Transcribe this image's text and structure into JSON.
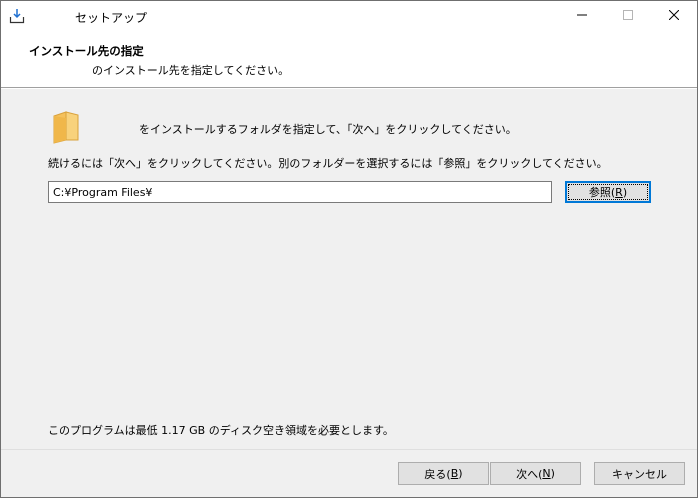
{
  "window": {
    "title": "セットアップ",
    "icons": {
      "app": "install-download-icon",
      "minimize": "minimize-icon",
      "maximize": "maximize-icon",
      "close": "close-icon"
    }
  },
  "header": {
    "title": "インストール先の指定",
    "subtitle": "のインストール先を指定してください。"
  },
  "main": {
    "folder_icon": "folder-icon",
    "intro": "をインストールするフォルダを指定して、「次へ」をクリックしてください。",
    "instruction": "続けるには「次へ」をクリックしてください。別のフォルダーを選択するには「参照」をクリックしてください。",
    "path_value": "C:¥Program Files¥",
    "browse_label": "参照(",
    "browse_key": "R",
    "browse_suffix": ")",
    "disk_space": "このプログラムは最低 1.17 GB のディスク空き領域を必要とします。"
  },
  "footer": {
    "back_label": "戻る(",
    "back_key": "B",
    "back_suffix": ")",
    "next_label": "次へ(",
    "next_key": "N",
    "next_suffix": ")",
    "cancel_label": "キャンセル"
  },
  "colors": {
    "folder": "#f5c15b",
    "focus_border": "#0078d7"
  }
}
